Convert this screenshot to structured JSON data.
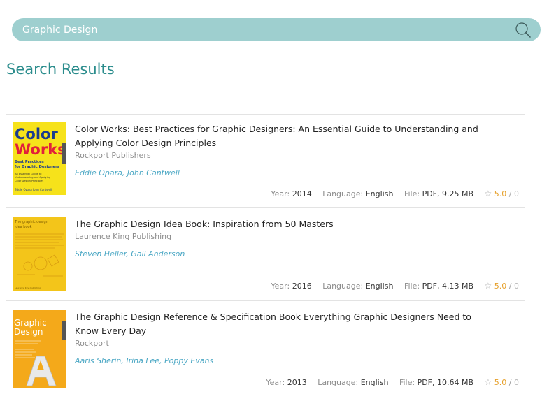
{
  "search": {
    "value": "Graphic Design",
    "placeholder": "Graphic Design"
  },
  "page_title": "Search Results",
  "labels": {
    "year": "Year:",
    "language": "Language:",
    "file": "File:",
    "rating_sep": "/"
  },
  "results": [
    {
      "title": "Color Works: Best Practices for Graphic Designers: An Essential Guide to Understanding and Applying Color Design Principles",
      "publisher": "Rockport Publishers",
      "authors": "Eddie Opara, John Cantwell",
      "year": "2014",
      "language": "English",
      "file": "PDF, 9.25 MB",
      "rating": "5.0",
      "rating_count": "0",
      "cover": {
        "line1": "Color",
        "line2": "Works",
        "sub": "Best Practices for Graphic Designers",
        "authors": "Eddie Opara  John Cantwell"
      }
    },
    {
      "title": "The Graphic Design Idea Book: Inspiration from 50 Masters",
      "publisher": "Laurence King Publishing",
      "authors": "Steven Heller, Gail Anderson",
      "year": "2016",
      "language": "English",
      "file": "PDF, 4.13 MB",
      "rating": "5.0",
      "rating_count": "0",
      "cover": {
        "line1": "The graphic design",
        "line2": "idea book"
      }
    },
    {
      "title": "The Graphic Design Reference & Specification Book Everything Graphic Designers Need to Know Every Day",
      "publisher": "Rockport",
      "authors": "Aaris Sherin, Irina Lee, Poppy Evans",
      "year": "2013",
      "language": "English",
      "file": "PDF, 10.64 MB",
      "rating": "5.0",
      "rating_count": "0",
      "cover": {
        "line1": "Graphic",
        "line2": "Design",
        "letter": "A"
      }
    }
  ],
  "colors": {
    "accent": "#2a8c8c",
    "search_bg": "#9ecfcf",
    "author_link": "#4aa7c4",
    "rating": "#e6a02a"
  }
}
